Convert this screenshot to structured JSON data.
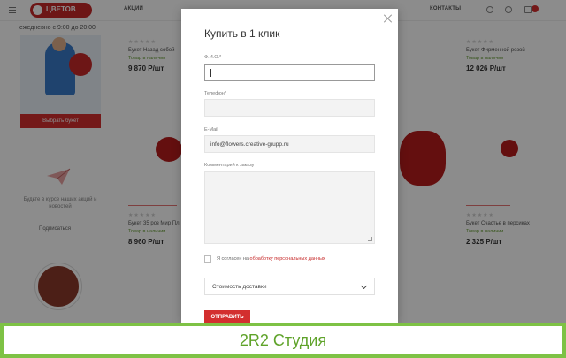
{
  "header": {
    "logo_text": "ЦВЕТОВ",
    "nav": [
      "АКЦИИ",
      "КОНТАКТЫ"
    ],
    "cart_count": ""
  },
  "sidebar": {
    "hours": "ежедневно с 9:00 до 20:00",
    "promo_button": "Выбрать букет",
    "subscribe_text": "Будьте в курсе наших акций и новостей",
    "subscribe_link": "Подписаться"
  },
  "cards": [
    {
      "title": "Букет Назад собой",
      "stock": "Товар в наличии",
      "price": "9 870 Р/шт"
    },
    {
      "title": "Букет Фирменной розой",
      "stock": "Товар в наличии",
      "price": "12 026 Р/шт"
    },
    {
      "title": "Букет 35 роз Мир Пл",
      "stock": "Товар в наличии",
      "price": "8 960 Р/шт"
    },
    {
      "title": "Букет Счастье в персиках",
      "stock": "Товар в наличии",
      "price": "2 325 Р/шт"
    }
  ],
  "modal": {
    "title": "Купить в 1 клик",
    "fields": {
      "fio_label": "Ф.И.О.*",
      "fio_value": "",
      "phone_label": "Телефон*",
      "phone_value": "",
      "email_label": "E-Mail",
      "email_value": "info@flowers.creative-grupp.ru",
      "comment_label": "Комментарий к заказу",
      "comment_value": ""
    },
    "consent_text": "Я согласен на",
    "consent_link": "обработку персональных данных",
    "delivery_select": "Стоимость доставки",
    "submit_label": "ОТПРАВИТЬ"
  },
  "footer": {
    "text": "2R2 Студия"
  },
  "colors": {
    "accent": "#d32f2f",
    "footer_border": "#7ec245",
    "footer_text": "#5fa32a"
  }
}
